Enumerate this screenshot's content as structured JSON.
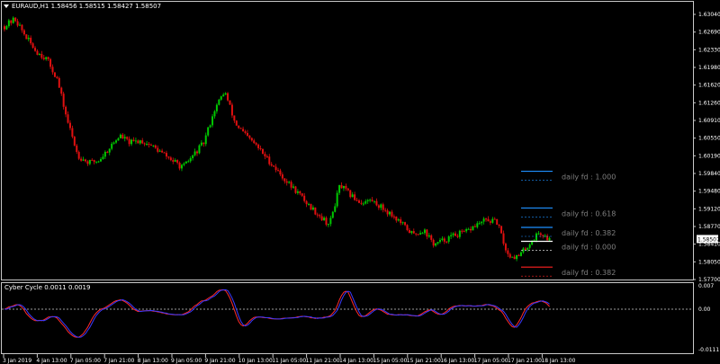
{
  "window": {
    "symbol_header": "EURAUD,H1  1.58456 1.58515 1.58427 1.58507",
    "menu_icon": "triangle-down-icon"
  },
  "indicator": {
    "title": "Cyber Cycle 0.0011 0.0019",
    "y_labels": [
      "0.007",
      "0.00",
      "-0.0111"
    ],
    "series_colors": {
      "line1": "#ff2a2a",
      "line2": "#3a3aff"
    },
    "zero_line_color": "#d0d0d0"
  },
  "price_axis": {
    "labels": [
      "1.63040",
      "1.62690",
      "1.62330",
      "1.61980",
      "1.61620",
      "1.61260",
      "1.60910",
      "1.60550",
      "1.60190",
      "1.59840",
      "1.59480",
      "1.59120",
      "1.58770",
      "1.58410",
      "1.58050",
      "1.57700"
    ],
    "current_price": "1.58507"
  },
  "time_axis": {
    "labels": [
      "3 Jan 2019",
      "4 Jan 13:00",
      "7 Jan 05:00",
      "7 Jan 21:00",
      "8 Jan 13:00",
      "9 Jan 05:00",
      "9 Jan 21:00",
      "10 Jan 13:00",
      "11 Jan 05:00",
      "11 Jan 21:00",
      "14 Jan 13:00",
      "15 Jan 05:00",
      "15 Jan 21:00",
      "16 Jan 13:00",
      "17 Jan 05:00",
      "17 Jan 21:00",
      "18 Jan 13:00"
    ]
  },
  "fib_levels": [
    {
      "label": "daily fd : 1.000",
      "price": 1.5988,
      "color": "#1e90ff"
    },
    {
      "label": "daily fd : 0.618",
      "price": 1.5914,
      "color": "#1e90ff"
    },
    {
      "label": "daily fd : 0.382",
      "price": 1.5875,
      "color": "#1e90ff"
    },
    {
      "label": "daily fd : 0.000",
      "price": 1.5847,
      "color": "#ffffff"
    },
    {
      "label": "daily fd : 0.382",
      "price": 1.5795,
      "color": "#ff2020"
    }
  ],
  "colors": {
    "background": "#000000",
    "bull_candle": "#00c800",
    "bear_candle": "#e01010",
    "grid_frame": "#c8c8c8",
    "text": "#ffffff"
  },
  "chart_data": {
    "type": "candlestick",
    "title": "EURAUD,H1",
    "ylim": [
      1.577,
      1.6304
    ],
    "close_trajectory": [
      1.628,
      1.6295,
      1.626,
      1.623,
      1.6215,
      1.6175,
      1.609,
      1.602,
      1.6005,
      1.601,
      1.6035,
      1.606,
      1.6045,
      1.605,
      1.604,
      1.6025,
      1.601,
      1.5995,
      1.602,
      1.6045,
      1.611,
      1.615,
      1.6085,
      1.606,
      1.604,
      1.6015,
      1.599,
      1.5965,
      1.5945,
      1.592,
      1.59,
      1.588,
      1.596,
      1.594,
      1.5925,
      1.593,
      1.5915,
      1.59,
      1.588,
      1.586,
      1.587,
      1.584,
      1.585,
      1.586,
      1.5865,
      1.588,
      1.589,
      1.5885,
      1.582,
      1.5815,
      1.584,
      1.5865,
      1.585
    ],
    "current_price": 1.58507
  }
}
